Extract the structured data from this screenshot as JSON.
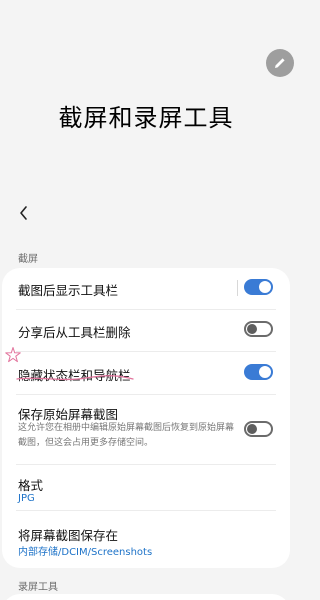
{
  "header": {
    "title": "截屏和录屏工具"
  },
  "icons": {
    "edit": "pencil-icon",
    "back": "chevron-left-icon"
  },
  "colors": {
    "accent": "#3a7bd5",
    "link": "#1e73c8",
    "fab": "#9e9e9e"
  },
  "sections": [
    {
      "label": "截屏"
    },
    {
      "label": "录屏工具"
    }
  ],
  "settings": [
    {
      "title": "截图后显示工具栏",
      "toggle": true
    },
    {
      "title": "分享后从工具栏删除",
      "toggle": false
    },
    {
      "title": "隐藏状态栏和导航栏",
      "toggle": true
    },
    {
      "title": "保存原始屏幕截图",
      "description": "这允许您在相册中编辑原始屏幕截图后恢复到原始屏幕截图，但这会占用更多存储空间。",
      "toggle": false
    },
    {
      "title": "格式",
      "value": "JPG"
    },
    {
      "title": "将屏幕截图保存在",
      "value": "内部存储/DCIM/Screenshots"
    }
  ]
}
